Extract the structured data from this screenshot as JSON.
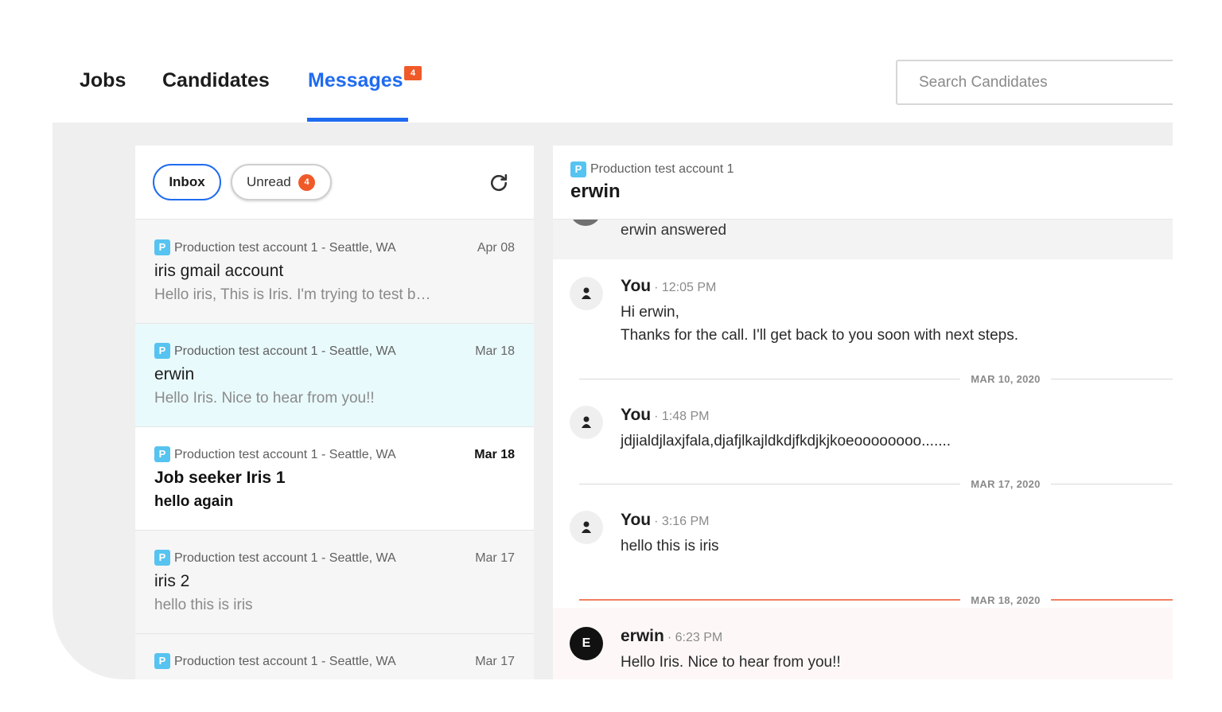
{
  "nav": {
    "tabs": [
      {
        "label": "Jobs"
      },
      {
        "label": "Candidates"
      },
      {
        "label": "Messages",
        "badge": "4"
      }
    ],
    "active_tab": "Messages",
    "search_placeholder": "Search Candidates"
  },
  "filters": {
    "inbox_label": "Inbox",
    "unread_label": "Unread",
    "unread_count": "4",
    "refresh_icon": "refresh-icon"
  },
  "conversations": [
    {
      "badge": "P",
      "account": "Production test account 1 - Seattle, WA",
      "date": "Apr 08",
      "name": "iris gmail account",
      "preview": "Hello iris, This is Iris. I'm trying to test b…"
    },
    {
      "badge": "P",
      "account": "Production test account 1 - Seattle, WA",
      "date": "Mar 18",
      "name": "erwin",
      "preview": "Hello Iris. Nice to hear from you!!"
    },
    {
      "badge": "P",
      "account": "Production test account 1 - Seattle, WA",
      "date": "Mar 18",
      "name": "Job seeker Iris 1",
      "preview": "hello again"
    },
    {
      "badge": "P",
      "account": "Production test account 1 - Seattle, WA",
      "date": "Mar 17",
      "name": "iris 2",
      "preview": "hello this is iris"
    },
    {
      "badge": "P",
      "account": "Production test account 1 - Seattle, WA",
      "date": "Mar 17",
      "name": "",
      "preview": ""
    }
  ],
  "thread": {
    "badge": "P",
    "account": "Production test account 1",
    "name": "erwin",
    "answered_text": "erwin answered",
    "messages": [
      {
        "sender": "You",
        "time": "· 12:05 PM",
        "lines": [
          "Hi erwin,",
          "Thanks for the call. I'll get back to you soon with next steps."
        ]
      },
      {
        "sender": "You",
        "time": "· 1:48 PM",
        "lines": [
          "jdjialdjlaxjfala,djafjlkajldkdjfkdjkjkoeoooooooo......."
        ]
      },
      {
        "sender": "You",
        "time": "· 3:16 PM",
        "lines": [
          "hello this is iris"
        ]
      },
      {
        "sender": "erwin",
        "avatar_letter": "E",
        "time": "· 6:23 PM",
        "lines": [
          "Hello Iris. Nice to hear from you!!"
        ]
      }
    ],
    "dividers": [
      "MAR 10, 2020",
      "MAR 17, 2020",
      "MAR 18, 2020"
    ]
  },
  "colors": {
    "accent": "#1f6bf0",
    "badge": "#f05a28",
    "account_badge": "#56c3f0",
    "selected_row": "#e9fafc"
  }
}
